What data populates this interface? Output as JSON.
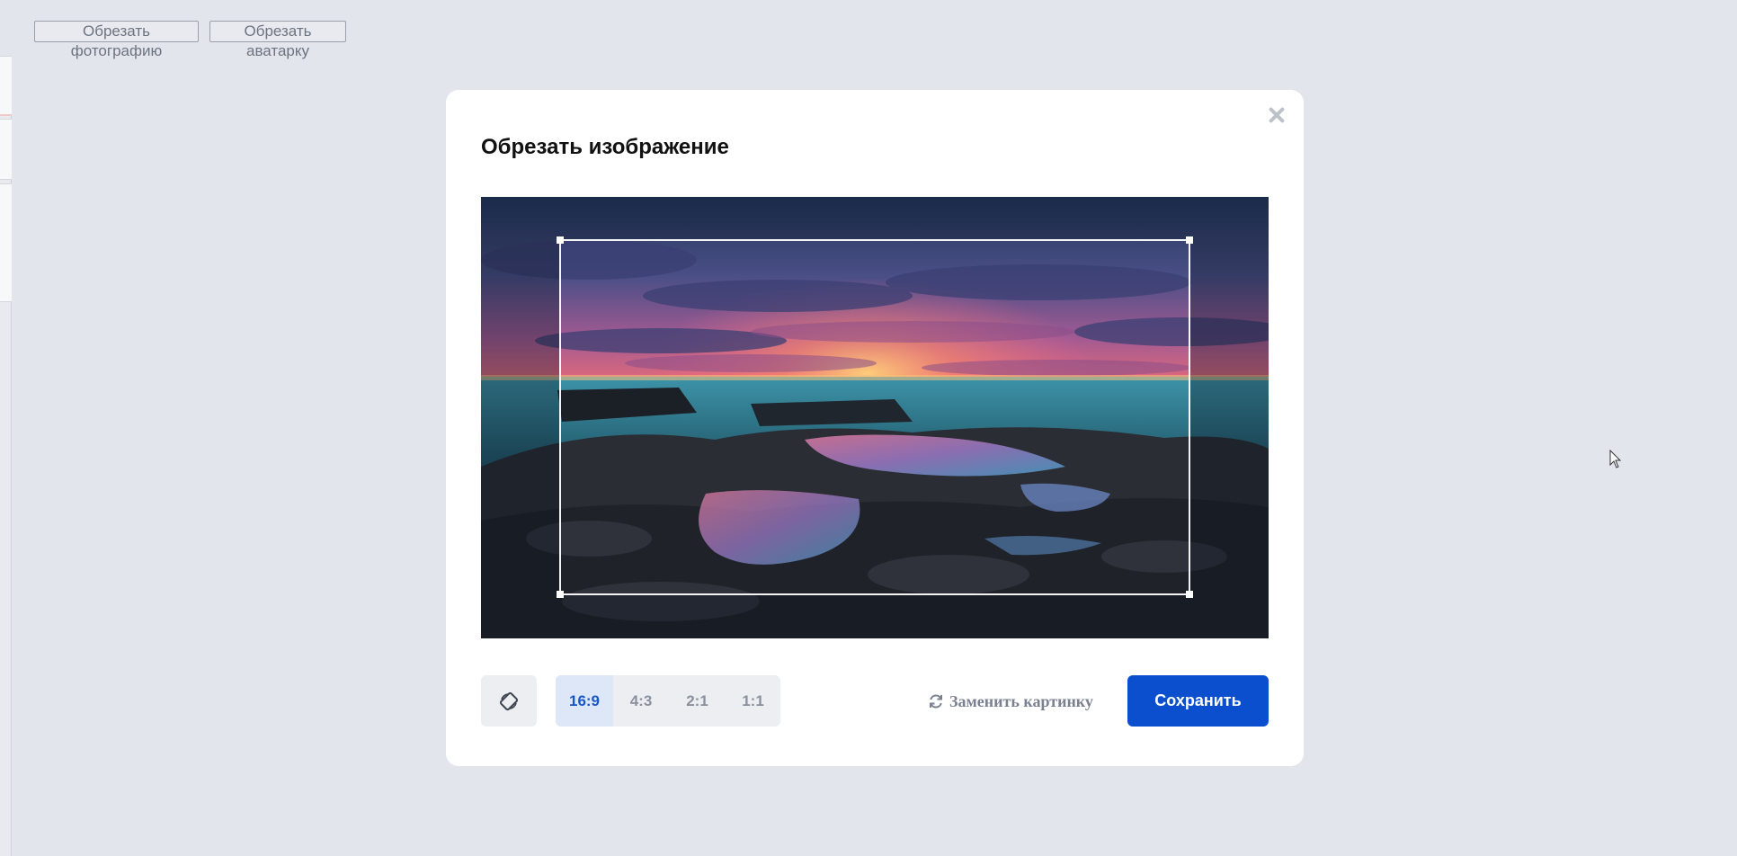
{
  "page": {
    "buttons": {
      "crop_photo": "Обрезать фотографию",
      "crop_avatar": "Обрезать аватарку"
    }
  },
  "modal": {
    "title": "Обрезать изображение",
    "close_icon": "close-icon",
    "image": {
      "description_icon": "seascape-image",
      "crop_ratio": "16:9"
    },
    "rotate_icon": "rotate-icon",
    "ratios": [
      {
        "label": "16:9",
        "active": true
      },
      {
        "label": "4:3",
        "active": false
      },
      {
        "label": "2:1",
        "active": false
      },
      {
        "label": "1:1",
        "active": false
      }
    ],
    "replace_label": "Заменить картинку",
    "replace_icon": "refresh-icon",
    "save_label": "Сохранить"
  },
  "colors": {
    "background": "#e2e5ec",
    "primary": "#0b4fcf",
    "active_ratio_text": "#1a56c4",
    "active_ratio_bg": "#dde7f7"
  }
}
